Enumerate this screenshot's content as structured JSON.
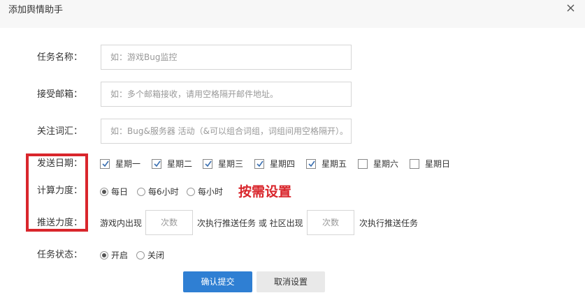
{
  "dialog": {
    "title": "添加舆情助手"
  },
  "form": {
    "task_name": {
      "label": "任务名称：",
      "placeholder": "如：游戏Bug监控"
    },
    "email": {
      "label": "接受邮箱：",
      "placeholder": "如：多个邮箱接收，请用空格隔开邮件地址。"
    },
    "keywords": {
      "label": "关注词汇：",
      "placeholder": "如：Bug&服务器 活动（&可以组合词组，词组间用空格隔开）。"
    },
    "send_date": {
      "label": "发送日期：",
      "days": [
        {
          "label": "星期一",
          "checked": true
        },
        {
          "label": "星期二",
          "checked": true
        },
        {
          "label": "星期三",
          "checked": true
        },
        {
          "label": "星期四",
          "checked": true
        },
        {
          "label": "星期五",
          "checked": true
        },
        {
          "label": "星期六",
          "checked": false
        },
        {
          "label": "星期日",
          "checked": false
        }
      ]
    },
    "compute_freq": {
      "label": "计算力度：",
      "options": [
        {
          "label": "每日",
          "selected": true
        },
        {
          "label": "每6小时",
          "selected": false
        },
        {
          "label": "每小时",
          "selected": false
        }
      ]
    },
    "push_freq": {
      "label": "推送力度：",
      "text_game": "游戏内出现",
      "placeholder_game": "次数",
      "text_middle": "次执行推送任务 或 社区出现",
      "placeholder_community": "次数",
      "text_end": "次执行推送任务"
    },
    "task_status": {
      "label": "任务状态：",
      "options": [
        {
          "label": "开启",
          "selected": true
        },
        {
          "label": "关闭",
          "selected": false
        }
      ]
    }
  },
  "annotation": {
    "text": "按需设置",
    "color": "#d9262c"
  },
  "buttons": {
    "confirm": "确认提交",
    "cancel": "取消设置"
  },
  "colors": {
    "primary": "#2f7fd3",
    "annotation_red": "#d9262c"
  },
  "icons": {
    "close": "close-icon",
    "check": "check-icon"
  }
}
